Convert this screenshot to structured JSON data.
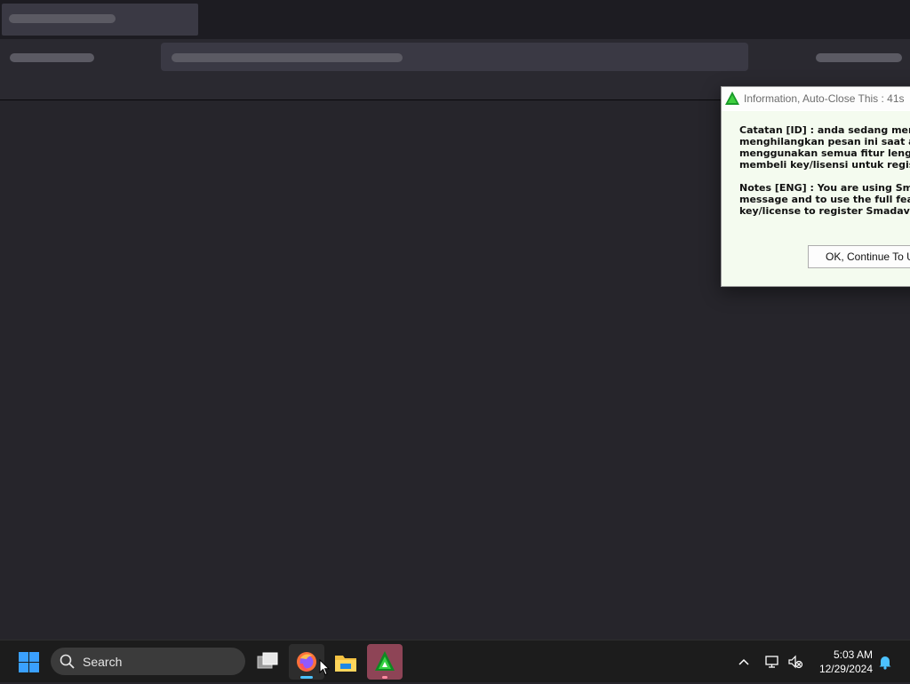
{
  "dialog": {
    "title": "Information, Auto-Close This : 41s",
    "id_lines": [
      "Catatan [ID] : anda sedang mengg",
      "menghilangkan pesan ini saat awa",
      "menggunakan semua fitur lengkap",
      "membeli key/lisensi untuk registr"
    ],
    "eng_lines": [
      "Notes [ENG] : You are using Smada",
      "message and to use the full featur",
      "key/license to register Smadav Pr"
    ],
    "button_label": "OK, Continue To Us"
  },
  "taskbar": {
    "search_label": "Search",
    "time": "5:03 AM",
    "date": "12/29/2024",
    "pinned": [
      "task-view-icon",
      "firefox-icon",
      "file-explorer-icon",
      "smadav-icon"
    ],
    "tray_icons": [
      "chevron-up-icon",
      "network-icon",
      "volume-muted-icon",
      "notification-bell-icon"
    ],
    "accent_color": "#4cc2ff",
    "smadav_highlight": "#8e4456"
  }
}
